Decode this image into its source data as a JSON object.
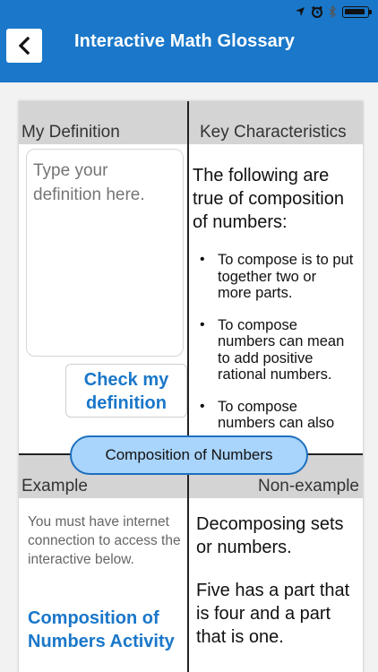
{
  "nav": {
    "title": "Interactive Math Glossary",
    "back_icon": "chevron-left-icon"
  },
  "status": {
    "icons": [
      "location-arrow-icon",
      "alarm-icon",
      "bluetooth-icon",
      "battery-icon"
    ]
  },
  "colors": {
    "brand_blue": "#1a77c9",
    "header_gray": "#d4d4d4",
    "pill_fill": "#a9d4fb",
    "pill_border": "#1e6fbf"
  },
  "my_definition": {
    "header": "My Definition",
    "placeholder": "Type your definition here.",
    "check_button": "Check my definition"
  },
  "key_characteristics": {
    "header": "Key Characteristics",
    "intro": "The following are true of composition of numbers:",
    "items": [
      "To compose is to put together two or more parts.",
      "To compose numbers can mean to add positive rational numbers.",
      "To compose numbers can also"
    ]
  },
  "term": "Composition of Numbers",
  "example": {
    "header": "Example",
    "note": "You must have internet connection to access the interactive below.",
    "link": "Composition of Numbers Activity"
  },
  "non_example": {
    "header": "Non-example",
    "p1": "Decomposing sets or numbers.",
    "p2": "Five has a part that is four and a part that is one."
  }
}
